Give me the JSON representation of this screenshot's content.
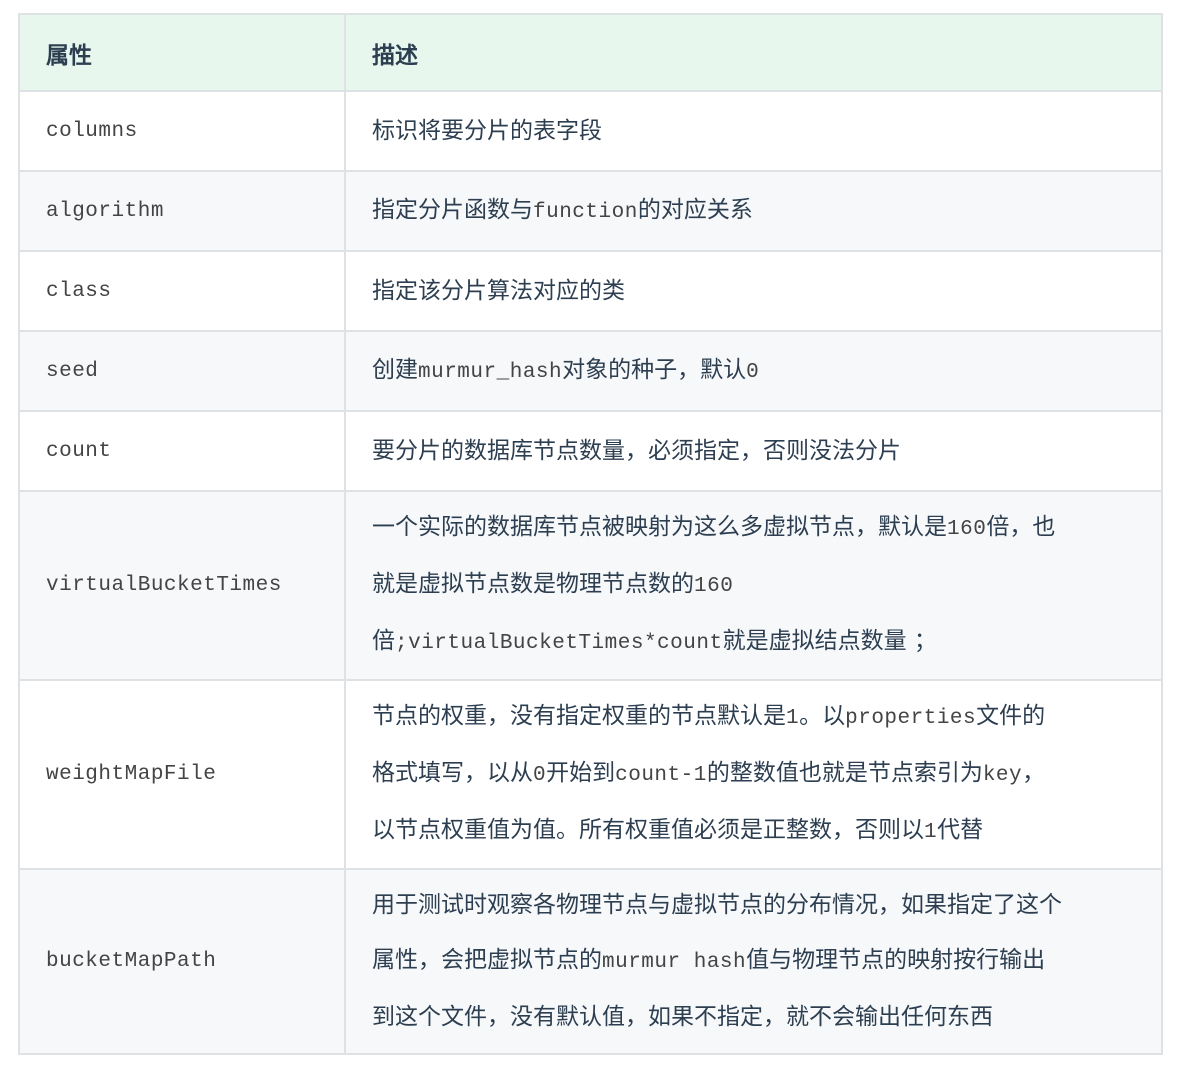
{
  "table": {
    "headers": [
      "属性",
      "描述"
    ],
    "rows": [
      {
        "name": "columns",
        "desc": [
          [
            {
              "t": "标识将要分片的表字段"
            }
          ]
        ]
      },
      {
        "name": "algorithm",
        "desc": [
          [
            {
              "t": "指定分片函数与"
            },
            {
              "c": "function"
            },
            {
              "t": "的对应关系"
            }
          ]
        ]
      },
      {
        "name": "class",
        "desc": [
          [
            {
              "t": "指定该分片算法对应的类"
            }
          ]
        ]
      },
      {
        "name": "seed",
        "desc": [
          [
            {
              "t": "创建"
            },
            {
              "c": "murmur_hash"
            },
            {
              "t": "对象的种子，默认"
            },
            {
              "c": "0"
            }
          ]
        ]
      },
      {
        "name": "count",
        "desc": [
          [
            {
              "t": "要分片的数据库节点数量，必须指定，否则没法分片"
            }
          ]
        ]
      },
      {
        "name": "virtualBucketTimes",
        "desc": [
          [
            {
              "t": "一个实际的数据库节点被映射为这么多虚拟节点，默认是"
            },
            {
              "c": "160"
            },
            {
              "t": "倍，也"
            }
          ],
          [
            {
              "t": "就是虚拟节点数是物理节点数的"
            },
            {
              "c": "160"
            }
          ],
          [
            {
              "t": "倍"
            },
            {
              "c": ";virtualBucketTimes*count"
            },
            {
              "t": "就是虚拟结点数量 ；"
            }
          ]
        ]
      },
      {
        "name": "weightMapFile",
        "desc": [
          [
            {
              "t": "节点的权重，没有指定权重的节点默认是"
            },
            {
              "c": "1"
            },
            {
              "t": "。以"
            },
            {
              "c": "properties"
            },
            {
              "t": "文件的"
            }
          ],
          [
            {
              "t": "格式填写，以从"
            },
            {
              "c": "0"
            },
            {
              "t": "开始到"
            },
            {
              "c": "count-1"
            },
            {
              "t": "的整数值也就是节点索引为"
            },
            {
              "c": "key"
            },
            {
              "t": "，"
            }
          ],
          [
            {
              "t": "以节点权重值为值。所有权重值必须是正整数，否则以"
            },
            {
              "c": "1"
            },
            {
              "t": "代替"
            }
          ]
        ]
      },
      {
        "name": "bucketMapPath",
        "desc": [
          [
            {
              "t": "用于测试时观察各物理节点与虚拟节点的分布情况，如果指定了这个"
            }
          ],
          [
            {
              "t": "属性，会把虚拟节点的"
            },
            {
              "c": "murmur hash"
            },
            {
              "t": "值与物理节点的映射按行输出"
            }
          ],
          [
            {
              "t": "到这个文件，没有默认值，如果不指定，就不会输出任何东西"
            }
          ]
        ]
      }
    ]
  }
}
